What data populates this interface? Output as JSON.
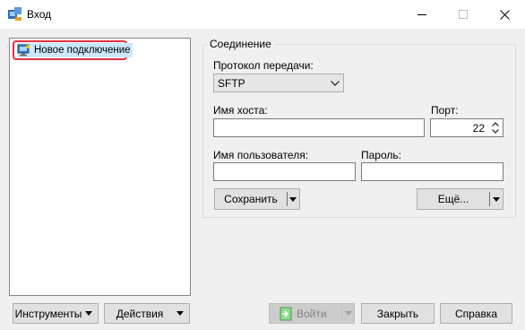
{
  "window": {
    "title": "Вход"
  },
  "sites": {
    "items": [
      {
        "label": "Новое подключение",
        "selected": true
      }
    ]
  },
  "connection": {
    "group_title": "Соединение",
    "protocol_label": "Протокол передачи:",
    "protocol_value": "SFTP",
    "host_label": "Имя хоста:",
    "host_value": "",
    "port_label": "Порт:",
    "port_value": "22",
    "user_label": "Имя пользователя:",
    "user_value": "",
    "password_label": "Пароль:",
    "password_value": "",
    "save_label": "Сохранить",
    "advanced_label": "Ещё..."
  },
  "bottom": {
    "tools_label": "Инструменты",
    "actions_label": "Действия",
    "login_label": "Войти",
    "close_label": "Закрыть",
    "help_label": "Справка"
  },
  "colors": {
    "selection_highlight": "#e63040",
    "selected_bg": "#cce8ff",
    "window_bg": "#f0f0f0"
  },
  "icons": {
    "app": "winscp-app-icon",
    "site": "new-site-computer-icon",
    "login": "login-door-icon"
  }
}
